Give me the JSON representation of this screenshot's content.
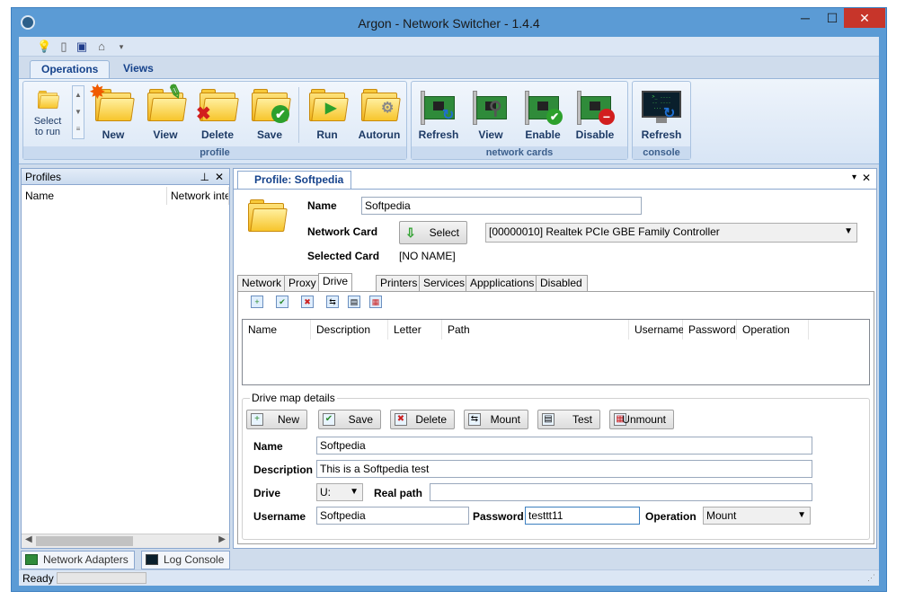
{
  "window": {
    "title": "Argon - Network Switcher - 1.4.4",
    "min": "─",
    "max": "☐",
    "close": "✕"
  },
  "quick_access": {
    "icons": [
      "bulb-icon",
      "document-icon",
      "save-icon",
      "tag-icon"
    ],
    "more": "▾"
  },
  "ribbon_tabs": [
    {
      "label": "Operations",
      "active": true
    },
    {
      "label": "Views",
      "active": false
    }
  ],
  "ribbon": {
    "profile_group": {
      "label": "profile",
      "select_label_1": "Select",
      "select_label_2": "to run",
      "buttons": [
        "New",
        "View",
        "Delete",
        "Save",
        "Run",
        "Autorun"
      ]
    },
    "network_group": {
      "label": "network cards",
      "buttons": [
        "Refresh",
        "View",
        "Enable",
        "Disable"
      ]
    },
    "console_group": {
      "label": "console",
      "buttons": [
        "Refresh"
      ]
    }
  },
  "profiles_panel": {
    "title": "Profiles",
    "pin": "⊥",
    "close": "✕",
    "columns": [
      "Name",
      "Network interf"
    ]
  },
  "bottom_tabs": [
    "Network Adapters",
    "Log Console"
  ],
  "status": {
    "text": "Ready"
  },
  "document": {
    "tab_label": "Profile: Softpedia",
    "menu": "▾",
    "close": "✕"
  },
  "profile_form": {
    "name_label": "Name",
    "name_value": "Softpedia",
    "network_card_label": "Network Card",
    "select_button": "Select",
    "network_card_value": "[00000010] Realtek PCIe GBE Family Controller",
    "selected_card_label": "Selected Card",
    "selected_card_value": "[NO NAME]"
  },
  "tabs": [
    {
      "label": "Network",
      "active": false
    },
    {
      "label": "Proxy",
      "active": false
    },
    {
      "label": "Drive Map",
      "active": true
    },
    {
      "label": "Printers",
      "active": false
    },
    {
      "label": "Services",
      "active": false
    },
    {
      "label": "Appplications",
      "active": false
    },
    {
      "label": "Disabled Adapters",
      "active": false
    }
  ],
  "grid": {
    "columns": [
      "Name",
      "Description",
      "Letter",
      "Path",
      "Username",
      "Password",
      "Operation"
    ]
  },
  "drive_map": {
    "legend": "Drive map details",
    "buttons": [
      "New",
      "Save",
      "Delete",
      "Mount",
      "Test",
      "Unmount"
    ],
    "name_label": "Name",
    "name_value": "Softpedia",
    "description_label": "Description",
    "description_value": "This is a Softpedia test",
    "drive_label": "Drive",
    "drive_value": "U:",
    "real_path_label": "Real path",
    "real_path_value": "",
    "username_label": "Username",
    "username_value": "Softpedia",
    "password_label": "Password",
    "password_value": "testtt11",
    "operation_label": "Operation",
    "operation_value": "Mount"
  },
  "colors": {
    "accent": "#5b9bd5",
    "ribbon_text": "#15428b",
    "close_red": "#c7352a"
  }
}
